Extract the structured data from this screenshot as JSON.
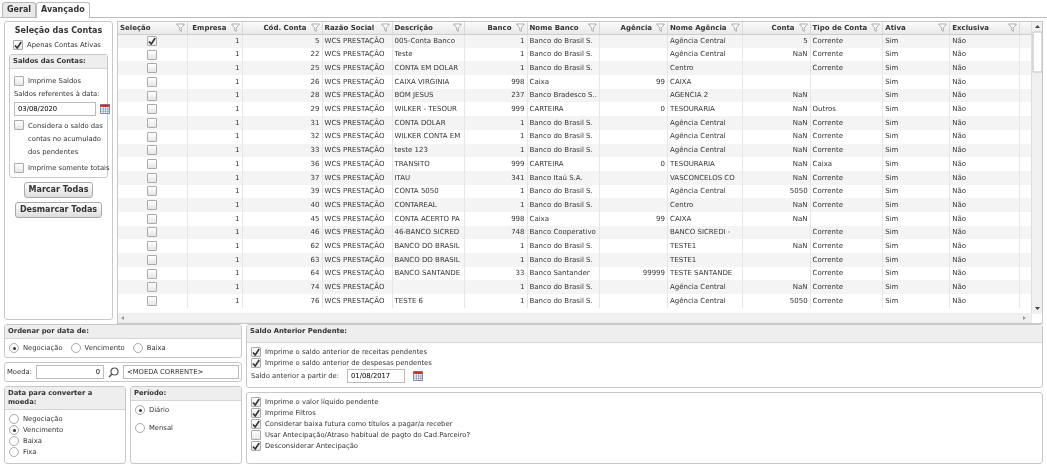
{
  "tabs": [
    {
      "label": "Geral",
      "selected": false
    },
    {
      "label": "Avançado",
      "selected": true
    }
  ],
  "selecao_contas": {
    "title": "Seleção das Contas",
    "options": [
      {
        "label": "Apenas Contas Ativas",
        "checked": true
      }
    ]
  },
  "saldos": {
    "title": "Saldos das Contas:",
    "imprime_saldos": {
      "label": "Imprime Saldos",
      "checked": false
    },
    "date_label": "Saldos referentes à data:",
    "date": "03/08/2020",
    "considera": {
      "label": "Considera o saldo das contas no acumulado dos pendentes",
      "checked": false
    },
    "somente_totais": {
      "label": "Imprime somente totais",
      "checked": false
    }
  },
  "buttons": [
    "Marcar Todas",
    "Desmarcar Todas"
  ],
  "table": {
    "selection_label": "Seleção",
    "columns": [
      "Empresa",
      "Cód. Conta",
      "Razão Social",
      "Descrição",
      "Banco",
      "Nome Banco",
      "Agência",
      "Nome Agência",
      "Conta",
      "Tipo de Conta",
      "Ativa",
      "Exclusiva"
    ],
    "rows": [
      {
        "checked": true,
        "cells": [
          "1",
          "5",
          "WCS PRESTAÇÃO",
          "005-Conta Banco",
          "1",
          "Banco do Brasil S.",
          null,
          "Agência Central",
          "5",
          "Corrente",
          "Sim",
          "Não"
        ]
      },
      {
        "checked": false,
        "cells": [
          "1",
          "22",
          "WCS PRESTAÇÃO",
          "Teste",
          "1",
          "Banco do Brasil S.",
          null,
          "Agência Central",
          "NaN",
          "Corrente",
          "Sim",
          "Não"
        ]
      },
      {
        "checked": false,
        "cells": [
          "1",
          "25",
          "WCS PRESTAÇÃO",
          "CONTA EM DOLAR",
          "1",
          "Banco do Brasil S.",
          null,
          "Centro",
          null,
          "Corrente",
          "Sim",
          "Não"
        ]
      },
      {
        "checked": false,
        "cells": [
          "1",
          "26",
          "WCS PRESTAÇÃO",
          "CAIXA VIRGINIA",
          "998",
          "Caixa",
          "99",
          "CAIXA",
          null,
          null,
          "Sim",
          "Não"
        ]
      },
      {
        "checked": false,
        "cells": [
          "1",
          "28",
          "WCS PRESTAÇÃO",
          "BOM JESUS",
          "237",
          "Banco Bradesco S..",
          null,
          "AGENCIA 2",
          "NaN",
          null,
          "Sim",
          "Não"
        ]
      },
      {
        "checked": false,
        "cells": [
          "1",
          "29",
          "WCS PRESTAÇÃO",
          "WILKER - TESOUR",
          "999",
          "CARTEIRA",
          "0",
          "TESOURARIA",
          "NaN",
          "Outros",
          "Sim",
          "Não"
        ]
      },
      {
        "checked": false,
        "cells": [
          "1",
          "31",
          "WCS PRESTAÇÃO",
          "CONTA DOLAR",
          "1",
          "Banco do Brasil S.",
          null,
          "Agência Central",
          "NaN",
          "Corrente",
          "Sim",
          "Não"
        ]
      },
      {
        "checked": false,
        "cells": [
          "1",
          "32",
          "WCS PRESTAÇÃO",
          "WILKER CONTA EM",
          "1",
          "Banco do Brasil S.",
          null,
          "Agência Central",
          "NaN",
          "Corrente",
          "Sim",
          "Não"
        ]
      },
      {
        "checked": false,
        "cells": [
          "1",
          "33",
          "WCS PRESTAÇÃO",
          "teste 123",
          "1",
          "Banco do Brasil S.",
          null,
          "Agência Central",
          "NaN",
          "Corrente",
          "Sim",
          "Não"
        ]
      },
      {
        "checked": false,
        "cells": [
          "1",
          "36",
          "WCS PRESTAÇÃO",
          "TRANSITO",
          "999",
          "CARTEIRA",
          "0",
          "TESOURARIA",
          "NaN",
          "Caixa",
          "Sim",
          "Não"
        ]
      },
      {
        "checked": false,
        "cells": [
          "1",
          "37",
          "WCS PRESTAÇÃO",
          "ITAU",
          "341",
          "Banco Itaú S.A.",
          null,
          "VASCONCELOS CO",
          "NaN",
          "Corrente",
          "Sim",
          "Não"
        ]
      },
      {
        "checked": false,
        "cells": [
          "1",
          "39",
          "WCS PRESTAÇÃO",
          "CONTA 5050",
          "1",
          "Banco do Brasil S.",
          null,
          "Agência Central",
          "5050",
          "Corrente",
          "Sim",
          "Não"
        ]
      },
      {
        "checked": false,
        "cells": [
          "1",
          "40",
          "WCS PRESTAÇÃO",
          "CONTAREAL",
          "1",
          "Banco do Brasil S.",
          null,
          "Centro",
          "NaN",
          "Corrente",
          "Sim",
          "Não"
        ]
      },
      {
        "checked": false,
        "cells": [
          "1",
          "45",
          "WCS PRESTAÇÃO",
          "CONTA ACERTO PA",
          "998",
          "Caixa",
          "99",
          "CAIXA",
          "NaN",
          null,
          "Sim",
          "Não"
        ]
      },
      {
        "checked": false,
        "cells": [
          "1",
          "46",
          "WCS PRESTAÇÃO",
          "46-BANCO SICRED",
          "748",
          "Banco Cooperativo",
          null,
          "BANCO SICREDI -",
          null,
          "Corrente",
          "Sim",
          "Não"
        ]
      },
      {
        "checked": false,
        "cells": [
          "1",
          "62",
          "WCS PRESTAÇÃO",
          "BANCO DO BRASIL",
          "1",
          "Banco do Brasil S.",
          null,
          "TESTE1",
          "NaN",
          "Corrente",
          "Sim",
          "Não"
        ]
      },
      {
        "checked": false,
        "cells": [
          "1",
          "63",
          "WCS PRESTAÇÃO",
          "BANCO DO BRASIL",
          "1",
          "Banco do Brasil S.",
          null,
          "TESTE1",
          null,
          "Corrente",
          "Sim",
          "Não"
        ]
      },
      {
        "checked": false,
        "cells": [
          "1",
          "64",
          "WCS PRESTAÇÃO",
          "BANCO SANTANDE",
          "33",
          "Banco Santander",
          "99999",
          "TESTE SANTANDE",
          null,
          "Corrente",
          "Sim",
          "Não"
        ]
      },
      {
        "checked": false,
        "cells": [
          "1",
          "74",
          "WCS PRESTAÇÃO",
          null,
          "1",
          "Banco do Brasil S.",
          null,
          "Agência Central",
          "NaN",
          "Corrente",
          "Sim",
          "Não"
        ]
      },
      {
        "checked": false,
        "cells": [
          "1",
          "76",
          "WCS PRESTAÇÃO",
          "TESTE 6",
          "1",
          "Banco do Brasil S.",
          null,
          "Agência Central",
          "5050",
          "Corrente",
          "Sim",
          "Não"
        ]
      }
    ]
  },
  "ordenar": {
    "title": "Ordenar por data de:",
    "options": [
      {
        "label": "Negociação",
        "selected": true
      },
      {
        "label": "Vencimento",
        "selected": false
      },
      {
        "label": "Baixa",
        "selected": false
      }
    ]
  },
  "moeda": {
    "label": "Moeda:",
    "value": "0",
    "name": "<MOEDA CORRENTE>"
  },
  "data_converter": {
    "title": "Data para converter a moeda:",
    "options": [
      {
        "label": "Negociação",
        "selected": false
      },
      {
        "label": "Vencimento",
        "selected": true
      },
      {
        "label": "Baixa",
        "selected": false
      },
      {
        "label": "Fixa",
        "selected": false
      }
    ]
  },
  "periodo": {
    "title": "Período:",
    "options": [
      {
        "label": "Diário",
        "selected": true
      },
      {
        "label": "Mensal",
        "selected": false
      }
    ]
  },
  "saldo_anterior": {
    "title": "Saldo Anterior Pendente:",
    "options": [
      {
        "label": "Imprime o saldo anterior de receitas pendentes",
        "checked": true
      },
      {
        "label": "Imprime o saldo anterior de despesas pendentes",
        "checked": true
      }
    ],
    "date_label": "Saldo anterior a partir de:",
    "date": "01/08/2017"
  },
  "opcoes": [
    {
      "label": "Imprime o valor líquido pendente",
      "checked": true
    },
    {
      "label": "Imprime Filtros",
      "checked": true
    },
    {
      "label": "Considerar baixa futura como títulos a pagar/a receber",
      "checked": true
    },
    {
      "label": "Usar Antecipação/Atraso habitual de pagto do Cad.Parceiro?",
      "checked": false
    },
    {
      "label": "Desconsiderar Antecipação",
      "checked": true
    }
  ]
}
